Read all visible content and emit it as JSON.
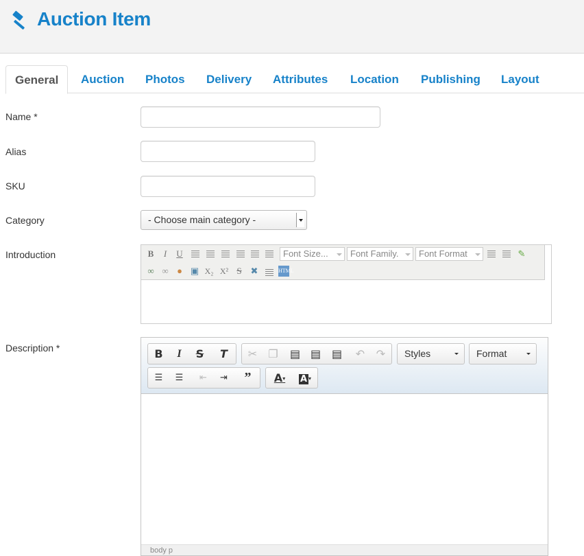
{
  "header": {
    "title": "Auction Item",
    "icon": "gavel-icon",
    "accent": "#1782c9"
  },
  "tabs": [
    {
      "label": "General",
      "active": true
    },
    {
      "label": "Auction",
      "active": false
    },
    {
      "label": "Photos",
      "active": false
    },
    {
      "label": "Delivery",
      "active": false
    },
    {
      "label": "Attributes",
      "active": false
    },
    {
      "label": "Location",
      "active": false
    },
    {
      "label": "Publishing",
      "active": false
    },
    {
      "label": "Layout",
      "active": false
    }
  ],
  "form": {
    "name_label": "Name *",
    "name_value": "",
    "alias_label": "Alias",
    "alias_value": "",
    "sku_label": "SKU",
    "sku_value": "",
    "category_label": "Category",
    "category_selected": "- Choose main category -",
    "introduction_label": "Introduction",
    "description_label": "Description *"
  },
  "intro_editor": {
    "font_size": "Font Size...",
    "font_family": "Font Family.",
    "font_format": "Font Format"
  },
  "desc_editor": {
    "styles": "Styles",
    "format": "Format",
    "status_path": "body   p"
  }
}
